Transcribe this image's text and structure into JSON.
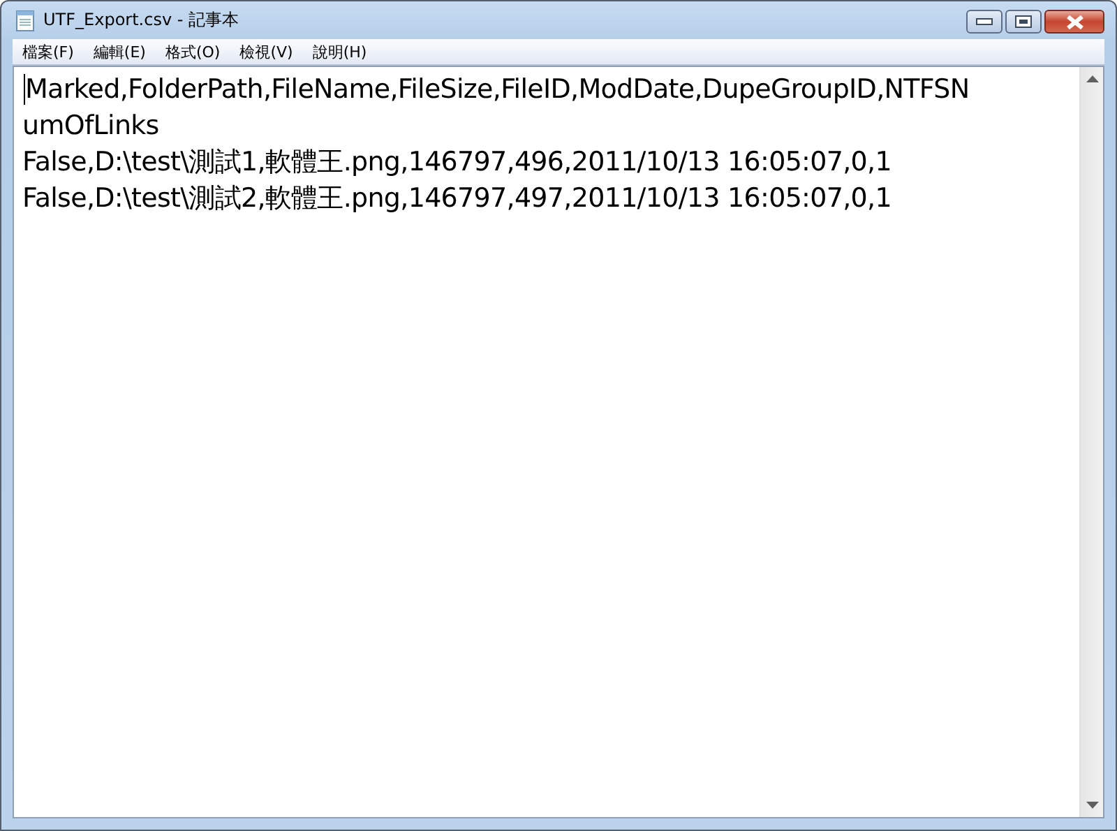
{
  "window": {
    "title": "UTF_Export.csv - 記事本"
  },
  "menu": [
    "檔案(F)",
    "編輯(E)",
    "格式(O)",
    "檢視(V)",
    "說明(H)"
  ],
  "document": {
    "lines": [
      "Marked,FolderPath,FileName,FileSize,FileID,ModDate,DupeGroupID,NTFSN",
      "umOfLinks",
      "False,D:\\test\\測試1,軟體王.png,146797,496,2011/10/13 16:05:07,0,1",
      "False,D:\\test\\測試2,軟體王.png,146797,497,2011/10/13 16:05:07,0,1"
    ]
  }
}
